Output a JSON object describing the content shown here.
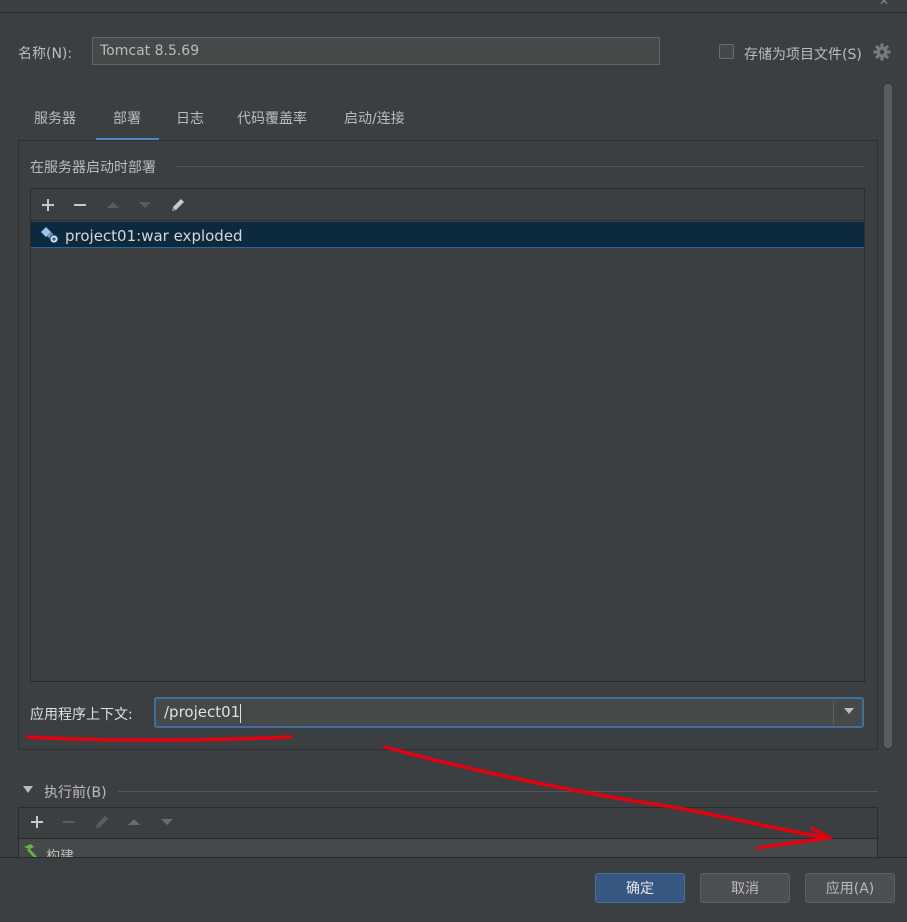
{
  "dialog": {
    "name_label": "名称(N):",
    "name_value": "Tomcat 8.5.69",
    "store_as_project_file_label": "存储为项目文件(S)",
    "store_as_project_file_checked": false
  },
  "tabs": [
    {
      "label": "服务器"
    },
    {
      "label": "部署",
      "active": true
    },
    {
      "label": "日志"
    },
    {
      "label": "代码覆盖率"
    },
    {
      "label": "启动/连接"
    }
  ],
  "deployment": {
    "group_title": "在服务器启动时部署",
    "toolbar": [
      "add-icon",
      "remove-icon",
      "move-up-icon",
      "move-down-icon",
      "edit-icon"
    ],
    "items": [
      {
        "label": "project01:war exploded",
        "selected": true
      }
    ],
    "app_context_label": "应用程序上下文:",
    "app_context_value": "/project01"
  },
  "before_launch": {
    "label": "执行前(B)",
    "toolbar": [
      "add-icon",
      "remove-icon",
      "edit-icon",
      "move-up-icon",
      "move-down-icon"
    ],
    "items": [
      {
        "label": "构建"
      }
    ]
  },
  "buttons": {
    "ok": "确定",
    "cancel": "取消",
    "apply": "应用(A)"
  },
  "colors": {
    "background": "#3c3f41",
    "selection": "#0d293e",
    "accent": "#4a88c7",
    "primary_button": "#365880",
    "annotation_red": "#e3000f"
  }
}
